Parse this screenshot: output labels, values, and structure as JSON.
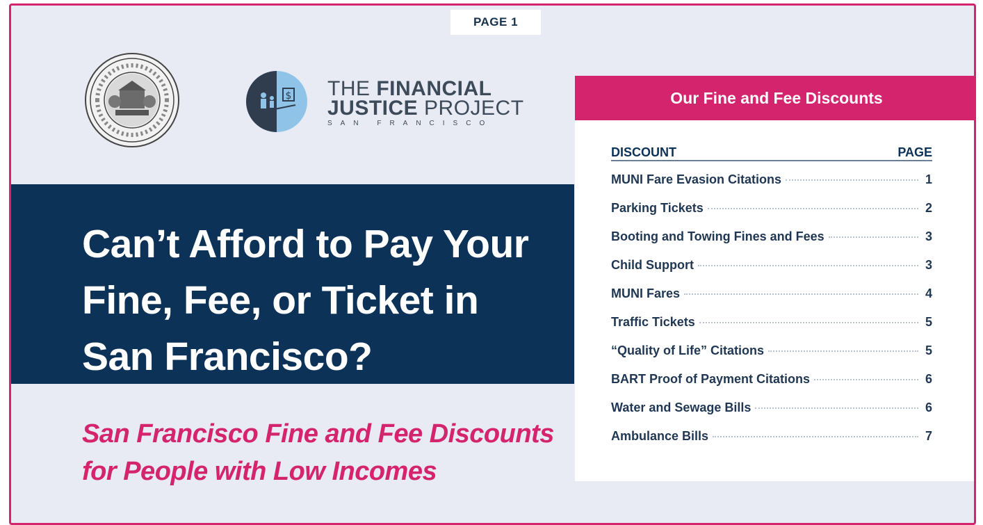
{
  "page_label": "PAGE 1",
  "logos": {
    "seal_icon": "city-county-seal-icon",
    "fjp_icon": "financial-justice-scale-icon",
    "fjp_line1_light": "THE ",
    "fjp_line1_bold": "FINANCIAL",
    "fjp_line2_bold": "JUSTICE",
    "fjp_line2_light": " PROJECT",
    "fjp_line3": "SAN FRANCISCO"
  },
  "hero": {
    "title_lines": [
      "Can’t Afford to Pay Your",
      "Fine, Fee, or Ticket in",
      "San Francisco?"
    ]
  },
  "subtitle": {
    "lines": [
      "San Francisco Fine and Fee Discounts",
      "for People with Low Incomes"
    ]
  },
  "toc": {
    "header": "Our Fine and Fee Discounts",
    "col_discount": "DISCOUNT",
    "col_page": "PAGE",
    "items": [
      {
        "label": "MUNI Fare Evasion Citations",
        "page": "1"
      },
      {
        "label": "Parking Tickets",
        "page": "2"
      },
      {
        "label": "Booting and Towing Fines and Fees",
        "page": "3"
      },
      {
        "label": "Child Support",
        "page": "3"
      },
      {
        "label": "MUNI Fares",
        "page": "4"
      },
      {
        "label": "Traffic Tickets",
        "page": "5"
      },
      {
        "label": "“Quality of Life” Citations",
        "page": "5"
      },
      {
        "label": "BART Proof of Payment Citations",
        "page": "6"
      },
      {
        "label": "Water and Sewage Bills",
        "page": "6"
      },
      {
        "label": "Ambulance Bills",
        "page": "7"
      }
    ]
  },
  "colors": {
    "accent": "#d4246e",
    "navy": "#0d3258",
    "background": "#e8ebf3"
  }
}
